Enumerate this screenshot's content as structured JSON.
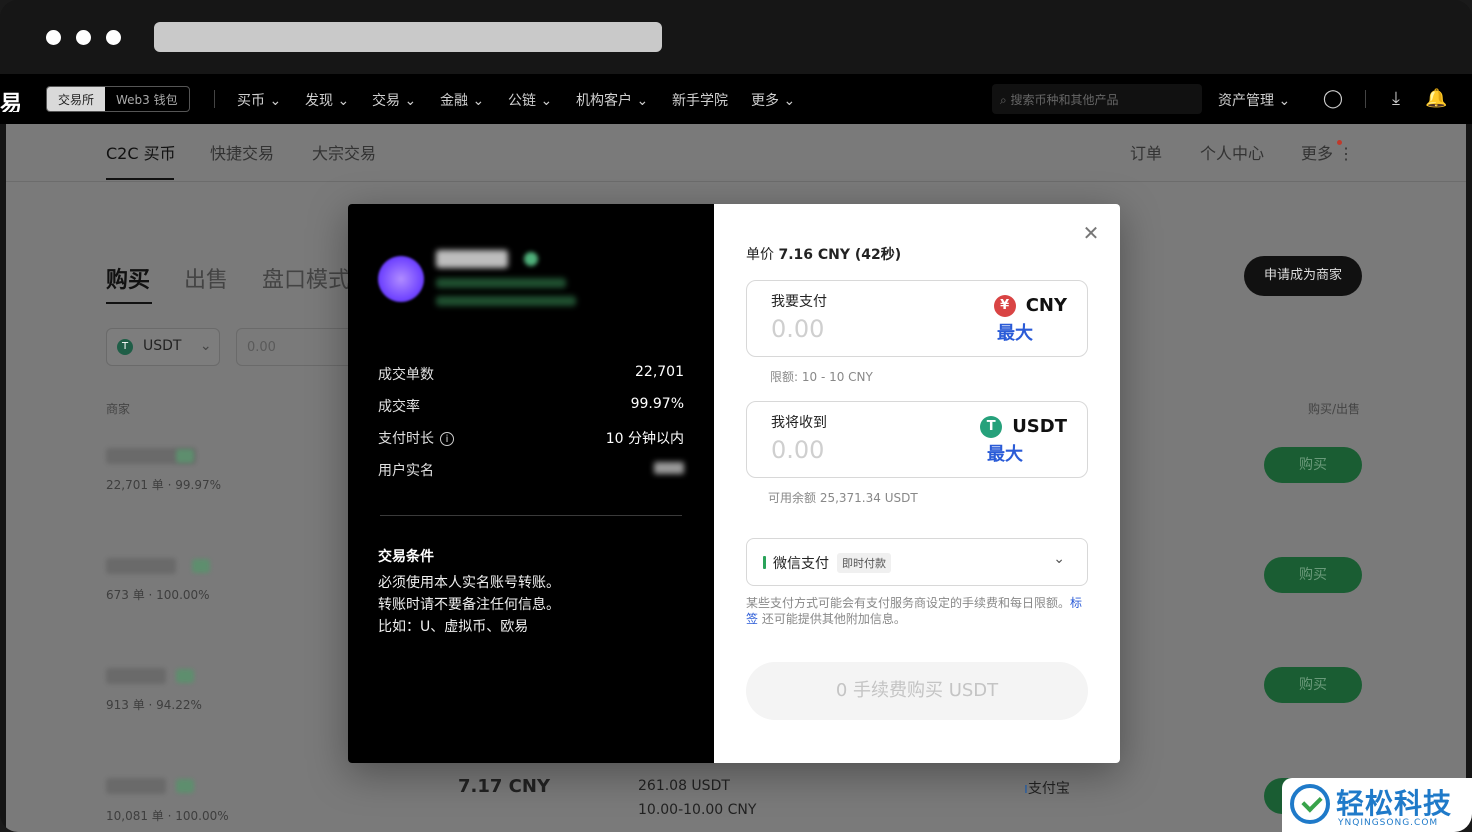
{
  "browser": {
    "dots": 3
  },
  "topnav": {
    "logo_fragment": "易",
    "segment": [
      "交易所",
      "Web3 钱包"
    ],
    "items": [
      "买币",
      "发现",
      "交易",
      "金融",
      "公链",
      "机构客户",
      "新手学院",
      "更多"
    ],
    "search_placeholder": "搜索币种和其他产品",
    "asset_mgmt": "资产管理"
  },
  "subnav": {
    "tabs": [
      "C2C 买币",
      "快捷交易",
      "大宗交易"
    ],
    "right_links": [
      "订单",
      "个人中心",
      "更多"
    ]
  },
  "trade": {
    "tabs": [
      "购买",
      "出售",
      "盘口模式"
    ],
    "become_merchant": "申请成为商家",
    "coin": "USDT",
    "amount_placeholder": "0.00",
    "col_merchant": "商家",
    "col_action": "购买/出售",
    "rows": [
      {
        "stats": "22,701 单 · 99.97%",
        "action": "购买"
      },
      {
        "stats": "673 单 · 100.00%",
        "action": "购买"
      },
      {
        "stats": "913 单 · 94.22%",
        "action": "购买"
      },
      {
        "stats": "10,081 单 · 100.00%",
        "action": "购买",
        "price": "7.17 CNY",
        "available": "261.08 USDT",
        "limit": "10.00-10.00 CNY",
        "payment": "支付宝"
      }
    ]
  },
  "modal": {
    "left": {
      "stats": [
        {
          "label": "成交单数",
          "value": "22,701"
        },
        {
          "label": "成交率",
          "value": "99.97%"
        },
        {
          "label": "支付时长",
          "value": "10 分钟以内"
        },
        {
          "label": "用户实名",
          "value": ""
        }
      ],
      "terms_title": "交易条件",
      "terms": [
        "必须使用本人实名账号转账。",
        "转账时请不要备注任何信息。",
        "比如：U、虚拟币、欧易"
      ]
    },
    "right": {
      "unit_price_label": "单价",
      "unit_price_value": "7.16 CNY (42秒)",
      "pay": {
        "label": "我要支付",
        "value": "0.00",
        "currency": "CNY",
        "currency_icon": "¥",
        "max": "最大"
      },
      "pay_limit": "限额: 10 - 10 CNY",
      "receive": {
        "label": "我将收到",
        "value": "0.00",
        "currency": "USDT",
        "currency_icon": "T",
        "max": "最大"
      },
      "balance": "可用余额 25,371.34 USDT",
      "payment_method": "微信支付",
      "payment_tag": "即时付款",
      "note_before": "某些支付方式可能会有支付服务商设定的手续费和每日限额。",
      "note_link": "标签",
      "note_after": " 还可能提供其他附加信息。",
      "submit": "0 手续费购买 USDT"
    }
  },
  "watermark": {
    "text": "轻松科技",
    "sub": "YNQINGSONG.COM"
  },
  "colors": {
    "accent_blue": "#2a5bd7",
    "buy_green": "#1a5d33",
    "usdt_green": "#26a17b",
    "cny_red": "#d94444"
  }
}
